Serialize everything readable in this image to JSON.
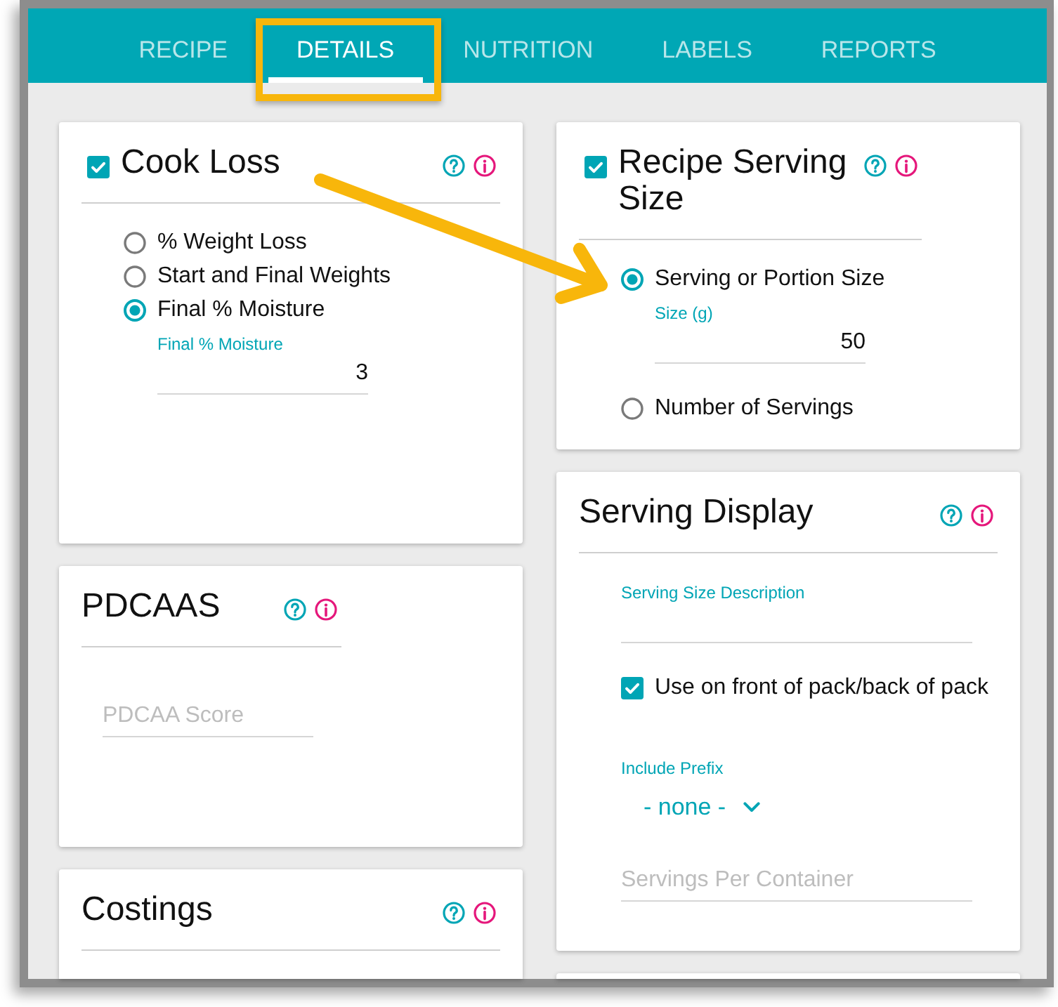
{
  "tabs": [
    {
      "label": "RECIPE",
      "selected": false,
      "highlighted": false
    },
    {
      "label": "DETAILS",
      "selected": true,
      "highlighted": true
    },
    {
      "label": "NUTRITION",
      "selected": false,
      "highlighted": false
    },
    {
      "label": "LABELS",
      "selected": false,
      "highlighted": false
    },
    {
      "label": "REPORTS",
      "selected": false,
      "highlighted": false
    }
  ],
  "columns": [
    {
      "cards": [
        {
          "title": "Cook Loss",
          "checked": true,
          "controls": [
            {
              "kind": "radio",
              "label": "% Weight Loss",
              "selected": false
            },
            {
              "kind": "radio",
              "label": "Start and Final Weights",
              "selected": false
            },
            {
              "kind": "radio",
              "label": "Final % Moisture",
              "selected": true,
              "field": {
                "label": "Final % Moisture",
                "value": "3"
              }
            }
          ]
        },
        {
          "title": "PDCAAS",
          "controls": [
            {
              "kind": "field",
              "placeholder": "PDCAA Score"
            }
          ]
        },
        {
          "title": "Costings"
        }
      ]
    },
    {
      "cards": [
        {
          "title": "Recipe Serving Size",
          "checked": true,
          "controls": [
            {
              "kind": "radio",
              "label": "Serving or Portion Size",
              "selected": true,
              "pointed_at": true,
              "field": {
                "label": "Size (g)",
                "value": "50"
              }
            },
            {
              "kind": "radio",
              "label": "Number of Servings",
              "selected": false
            }
          ]
        },
        {
          "title": "Serving Display",
          "controls": [
            {
              "kind": "field",
              "label": "Serving Size Description"
            },
            {
              "kind": "checkbox",
              "label": "Use on front of pack/back of pack",
              "checked": true
            },
            {
              "kind": "select",
              "label": "Include Prefix",
              "value": "- none -"
            },
            {
              "kind": "field",
              "placeholder": "Servings Per Container"
            }
          ]
        }
      ],
      "more_cards_below": true
    }
  ]
}
